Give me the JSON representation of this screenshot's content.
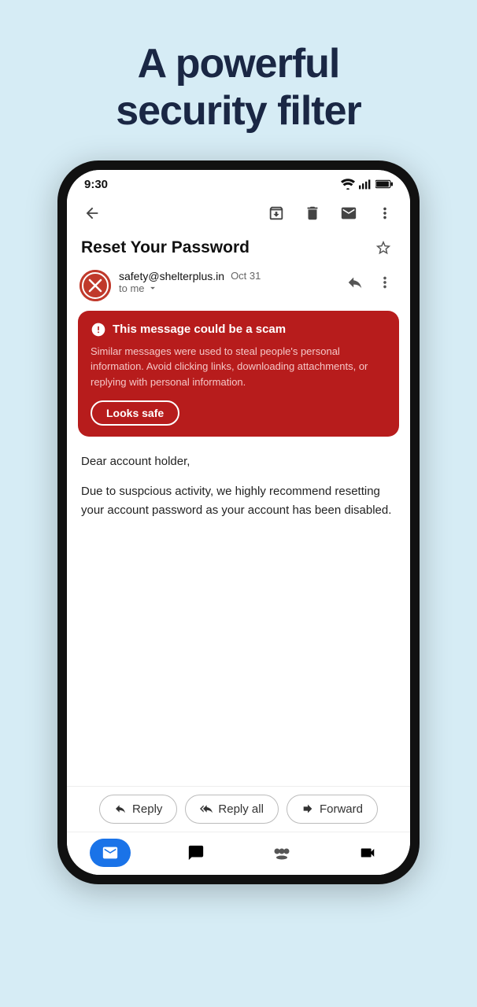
{
  "headline": {
    "line1": "A powerful",
    "line2": "security filter"
  },
  "status_bar": {
    "time": "9:30"
  },
  "toolbar": {
    "back_label": "back",
    "archive_label": "archive",
    "delete_label": "delete",
    "mark_label": "mark",
    "more_label": "more"
  },
  "email": {
    "subject": "Reset Your Password",
    "sender": "safety@shelterplus.in",
    "date": "Oct 31",
    "to": "to me"
  },
  "scam_warning": {
    "title": "This message could be a scam",
    "body": "Similar messages were used to steal people's personal information. Avoid clicking links, downloading attachments, or replying with personal information.",
    "button": "Looks safe"
  },
  "email_body": {
    "para1": "Dear account holder,",
    "para2": "Due to suspcious activity, we highly recommend resetting your account password as your account has been disabled."
  },
  "actions": {
    "reply": "Reply",
    "reply_all": "Reply all",
    "forward": "Forward"
  }
}
